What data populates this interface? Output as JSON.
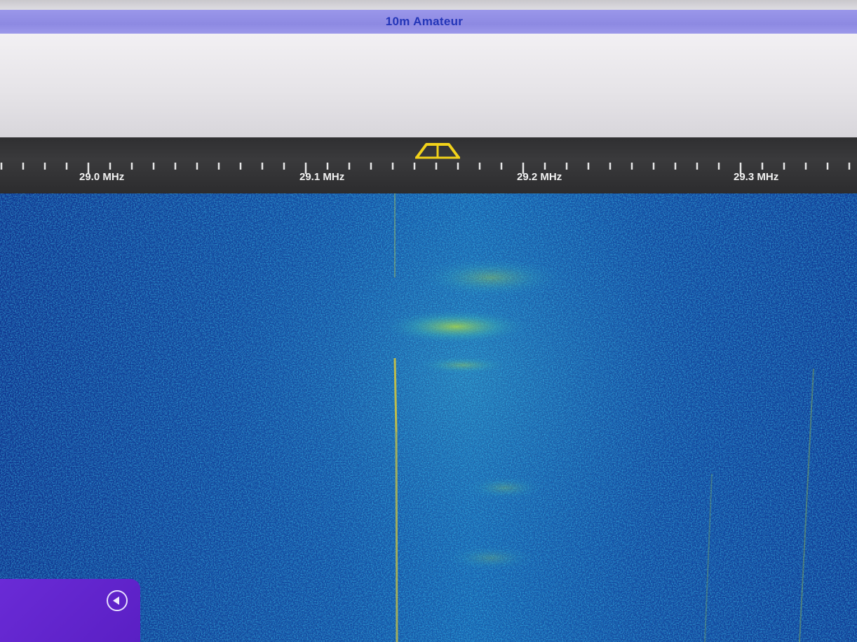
{
  "band": {
    "label": "10m Amateur"
  },
  "frequency_scale": {
    "labels": [
      "29.0 MHz",
      "29.1 MHz",
      "29.2 MHz",
      "29.3 MHz"
    ]
  },
  "colors": {
    "band_bar": "#8d89e2",
    "band_text": "#2335b8",
    "scale_background": "#2f2f31",
    "filter_marker": "#f2d21a",
    "waterfall_base": "#0b2a7a",
    "waterfall_signal": "#c8e83a",
    "panel": "#6a2bd6"
  },
  "icons": {
    "filter_marker": "passband-filter-icon",
    "collapse": "chevron-left-circle-icon"
  }
}
